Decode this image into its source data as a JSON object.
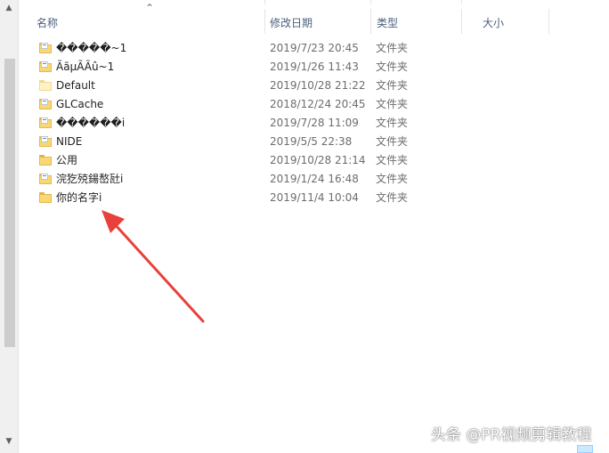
{
  "columns": {
    "name": "名称",
    "date": "修改日期",
    "type": "类型",
    "size": "大小"
  },
  "files": [
    {
      "name": "�����~1",
      "date": "2019/7/23 20:45",
      "type": "文件夹",
      "icon": "folder-doc-icon"
    },
    {
      "name": "ÃãµÃÃû~1",
      "date": "2019/1/26 11:43",
      "type": "文件夹",
      "icon": "folder-doc-icon"
    },
    {
      "name": "Default",
      "date": "2019/10/28 21:22",
      "type": "文件夹",
      "icon": "folder-plain-icon"
    },
    {
      "name": "GLCache",
      "date": "2018/12/24 20:45",
      "type": "文件夹",
      "icon": "folder-doc-icon"
    },
    {
      "name": "������i",
      "date": "2019/7/28 11:09",
      "type": "文件夹",
      "icon": "folder-doc-icon"
    },
    {
      "name": "NIDE",
      "date": "2019/5/5 22:38",
      "type": "文件夹",
      "icon": "folder-doc-icon"
    },
    {
      "name": "公用",
      "date": "2019/10/28 21:14",
      "type": "文件夹",
      "icon": "folder-icon"
    },
    {
      "name": "浣犵殑鍚嶅瓧i",
      "date": "2019/1/24 16:48",
      "type": "文件夹",
      "icon": "folder-doc-icon"
    },
    {
      "name": "你的名字i",
      "date": "2019/11/4 10:04",
      "type": "文件夹",
      "icon": "folder-icon"
    }
  ],
  "watermark": "头条 @PR视频剪辑教程",
  "colors": {
    "header_text": "#4c607a",
    "arrow": "#e8413c",
    "folder": "#f8d775"
  }
}
